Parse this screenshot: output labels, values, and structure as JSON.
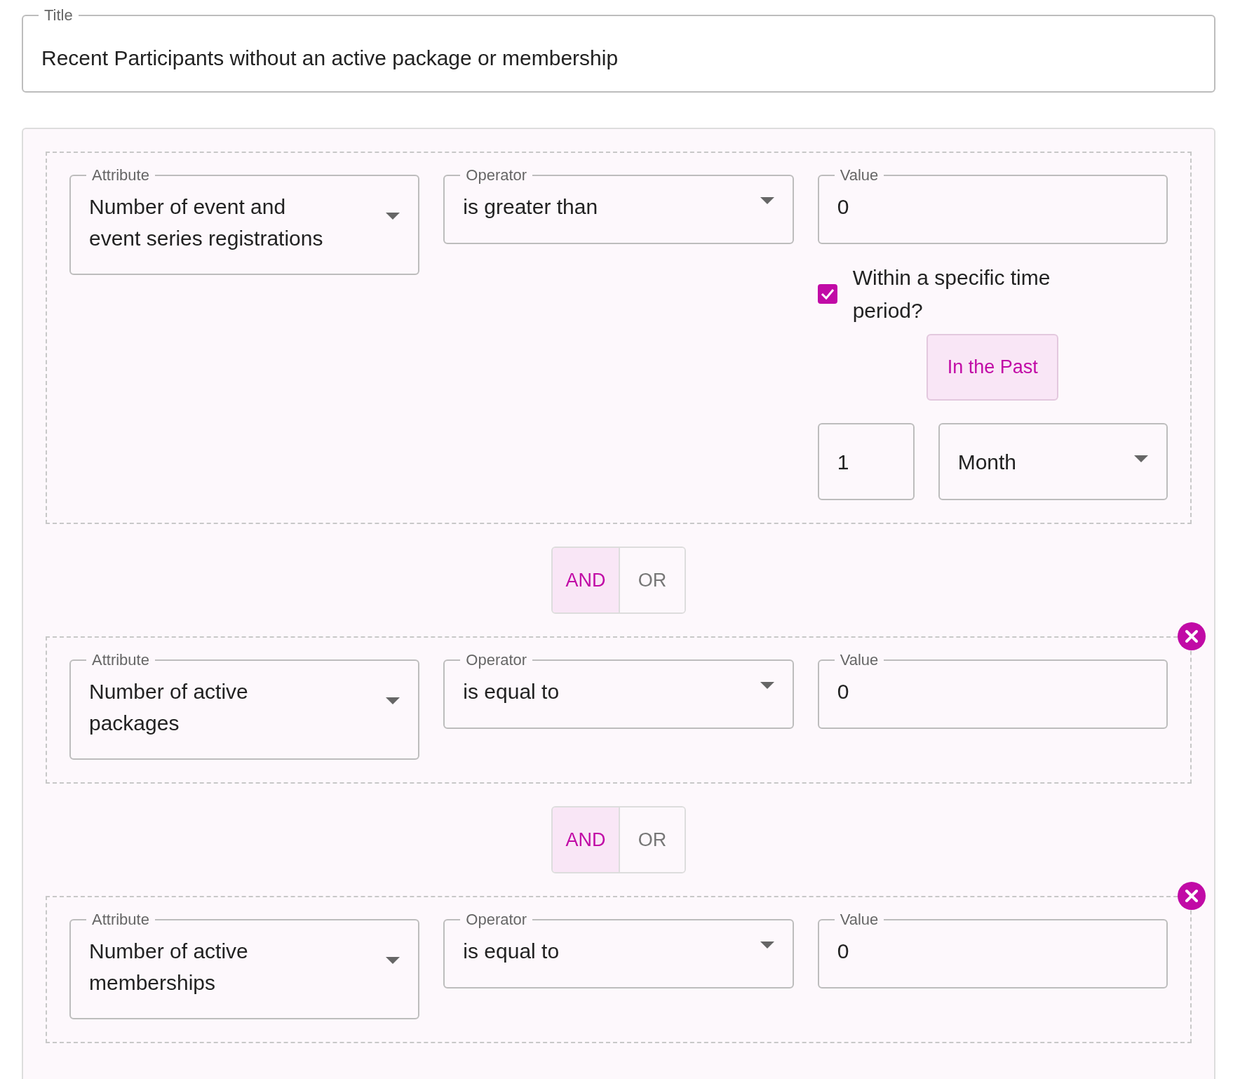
{
  "title_field": {
    "label": "Title",
    "value": "Recent Participants without an active package or membership"
  },
  "rules": [
    {
      "kind": "condition",
      "removable": false,
      "attribute": {
        "label": "Attribute",
        "value": "Number of event and event series registrations"
      },
      "operator": {
        "label": "Operator",
        "value": "is greater than"
      },
      "value": {
        "label": "Value",
        "value": "0"
      },
      "time_period": {
        "label": "Within a specific time period?",
        "checked": true,
        "direction": "In the Past",
        "amount": "1",
        "unit": "Month"
      }
    },
    {
      "kind": "connector",
      "options": [
        {
          "label": "AND",
          "selected": true
        },
        {
          "label": "OR",
          "selected": false
        }
      ]
    },
    {
      "kind": "condition",
      "removable": true,
      "attribute": {
        "label": "Attribute",
        "value": "Number of active packages"
      },
      "operator": {
        "label": "Operator",
        "value": "is equal to"
      },
      "value": {
        "label": "Value",
        "value": "0"
      }
    },
    {
      "kind": "connector",
      "options": [
        {
          "label": "AND",
          "selected": true
        },
        {
          "label": "OR",
          "selected": false
        }
      ]
    },
    {
      "kind": "condition",
      "removable": true,
      "attribute": {
        "label": "Attribute",
        "value": "Number of active memberships"
      },
      "operator": {
        "label": "Operator",
        "value": "is equal to"
      },
      "value": {
        "label": "Value",
        "value": "0"
      }
    }
  ]
}
